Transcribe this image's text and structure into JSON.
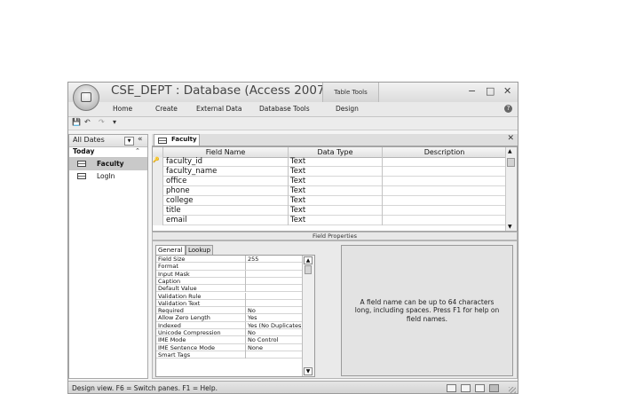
{
  "window": {
    "title": "CSE_DEPT : Database (Access 2007) -",
    "tool_context": "Table Tools",
    "minimize": "−",
    "maximize": "□",
    "close": "✕"
  },
  "ribbon": {
    "tabs": [
      "Home",
      "Create",
      "External Data",
      "Database Tools",
      "Design"
    ],
    "help": "?"
  },
  "quick_access": {
    "save": "💾",
    "undo": "↶",
    "redo": "↷",
    "customize": "▾"
  },
  "nav_pane": {
    "header": "All Dates",
    "dropdown": "▼",
    "collapse": "«",
    "group": "Today",
    "group_chevron": "⌃",
    "items": [
      {
        "label": "Faculty",
        "selected": true
      },
      {
        "label": "LogIn",
        "selected": false
      }
    ]
  },
  "document": {
    "tab_label": "Faculty",
    "close": "✕",
    "columns": [
      "Field Name",
      "Data Type",
      "Description"
    ],
    "rows": [
      {
        "field": "faculty_id",
        "type": "Text",
        "key": "🔑"
      },
      {
        "field": "faculty_name",
        "type": "Text",
        "key": ""
      },
      {
        "field": "office",
        "type": "Text",
        "key": ""
      },
      {
        "field": "phone",
        "type": "Text",
        "key": ""
      },
      {
        "field": "college",
        "type": "Text",
        "key": ""
      },
      {
        "field": "title",
        "type": "Text",
        "key": ""
      },
      {
        "field": "email",
        "type": "Text",
        "key": ""
      }
    ],
    "scroll_up": "▲",
    "scroll_down": "▼"
  },
  "field_properties": {
    "title": "Field Properties",
    "tabs": [
      "General",
      "Lookup"
    ],
    "properties": [
      {
        "name": "Field Size",
        "value": "255"
      },
      {
        "name": "Format",
        "value": ""
      },
      {
        "name": "Input Mask",
        "value": ""
      },
      {
        "name": "Caption",
        "value": ""
      },
      {
        "name": "Default Value",
        "value": ""
      },
      {
        "name": "Validation Rule",
        "value": ""
      },
      {
        "name": "Validation Text",
        "value": ""
      },
      {
        "name": "Required",
        "value": "No"
      },
      {
        "name": "Allow Zero Length",
        "value": "Yes"
      },
      {
        "name": "Indexed",
        "value": "Yes (No Duplicates)"
      },
      {
        "name": "Unicode Compression",
        "value": "No"
      },
      {
        "name": "IME Mode",
        "value": "No Control"
      },
      {
        "name": "IME Sentence Mode",
        "value": "None"
      },
      {
        "name": "Smart Tags",
        "value": ""
      }
    ],
    "scroll_up": "▲",
    "scroll_down": "▼",
    "help_text": "A field name can be up to 64 characters long, including spaces.  Press F1 for help on field names."
  },
  "status_bar": {
    "text": "Design view.  F6 = Switch panes.  F1 = Help."
  }
}
